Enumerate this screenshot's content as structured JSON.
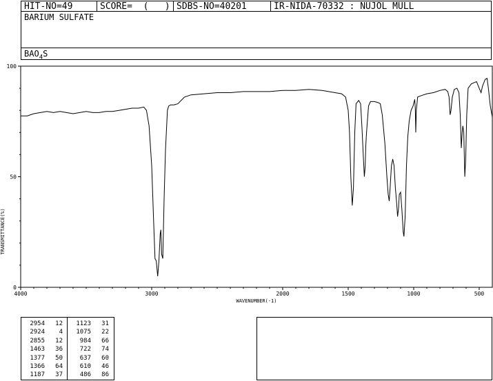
{
  "header": {
    "hit_no": "HIT-NO=49",
    "score": "SCORE=  (   )",
    "sdbs_no": "SDBS-NO=40201",
    "ir_nida": "IR-NIDA-70332 : NUJOL MULL"
  },
  "compound": {
    "name": "BARIUM SULFATE",
    "formula_pre": "BAO",
    "formula_sub": "4",
    "formula_post": "S"
  },
  "chart_data": {
    "type": "line",
    "xlabel": "WAVENUMBER(-1)",
    "ylabel": "TRANSMITTANCE(%)",
    "xlim": [
      4000,
      400
    ],
    "ylim": [
      0,
      100
    ],
    "x_ticks": [
      4000,
      3000,
      2000,
      1500,
      1000,
      500
    ],
    "y_ticks": [
      0,
      50,
      100
    ],
    "x_tick_labels": [
      "4000",
      "3000",
      "2000",
      "1500",
      "1000",
      "500"
    ],
    "y_tick_labels": [
      "0",
      "50",
      "100"
    ],
    "grid": false,
    "series": [
      {
        "points": [
          [
            4000,
            77.5
          ],
          [
            3950,
            77.5
          ],
          [
            3900,
            78.5
          ],
          [
            3850,
            79
          ],
          [
            3800,
            79.5
          ],
          [
            3750,
            79
          ],
          [
            3700,
            79.5
          ],
          [
            3650,
            79
          ],
          [
            3600,
            78.5
          ],
          [
            3550,
            79
          ],
          [
            3500,
            79.5
          ],
          [
            3450,
            79
          ],
          [
            3400,
            79
          ],
          [
            3350,
            79.5
          ],
          [
            3300,
            79.5
          ],
          [
            3250,
            80
          ],
          [
            3200,
            80.5
          ],
          [
            3150,
            81
          ],
          [
            3100,
            81
          ],
          [
            3060,
            81.5
          ],
          [
            3040,
            80
          ],
          [
            3020,
            73
          ],
          [
            3000,
            55
          ],
          [
            2985,
            30
          ],
          [
            2975,
            13
          ],
          [
            2965,
            12
          ],
          [
            2954,
            5
          ],
          [
            2945,
            12
          ],
          [
            2935,
            24
          ],
          [
            2930,
            26
          ],
          [
            2924,
            15
          ],
          [
            2915,
            13
          ],
          [
            2905,
            40
          ],
          [
            2895,
            62
          ],
          [
            2880,
            80
          ],
          [
            2870,
            82
          ],
          [
            2855,
            82.5
          ],
          [
            2830,
            82.5
          ],
          [
            2800,
            83
          ],
          [
            2750,
            86
          ],
          [
            2700,
            87
          ],
          [
            2600,
            87.5
          ],
          [
            2500,
            88
          ],
          [
            2400,
            88
          ],
          [
            2300,
            88.5
          ],
          [
            2200,
            88.5
          ],
          [
            2100,
            88.5
          ],
          [
            2000,
            89
          ],
          [
            1900,
            89
          ],
          [
            1800,
            89.5
          ],
          [
            1700,
            89
          ],
          [
            1600,
            88
          ],
          [
            1550,
            87.5
          ],
          [
            1520,
            86
          ],
          [
            1500,
            80
          ],
          [
            1490,
            70
          ],
          [
            1480,
            50
          ],
          [
            1469,
            37
          ],
          [
            1460,
            45
          ],
          [
            1450,
            70
          ],
          [
            1440,
            83
          ],
          [
            1420,
            84.5
          ],
          [
            1405,
            83
          ],
          [
            1395,
            72
          ],
          [
            1385,
            60
          ],
          [
            1377,
            50
          ],
          [
            1370,
            55
          ],
          [
            1366,
            64
          ],
          [
            1360,
            70
          ],
          [
            1345,
            82
          ],
          [
            1330,
            84
          ],
          [
            1300,
            84
          ],
          [
            1270,
            83.5
          ],
          [
            1255,
            83
          ],
          [
            1240,
            78
          ],
          [
            1220,
            65
          ],
          [
            1205,
            50
          ],
          [
            1195,
            42
          ],
          [
            1187,
            39
          ],
          [
            1180,
            45
          ],
          [
            1170,
            55
          ],
          [
            1160,
            58
          ],
          [
            1150,
            55
          ],
          [
            1140,
            45
          ],
          [
            1130,
            38
          ],
          [
            1123,
            32
          ],
          [
            1115,
            36
          ],
          [
            1110,
            42
          ],
          [
            1100,
            43
          ],
          [
            1090,
            35
          ],
          [
            1080,
            25
          ],
          [
            1075,
            23
          ],
          [
            1065,
            32
          ],
          [
            1055,
            55
          ],
          [
            1045,
            68
          ],
          [
            1035,
            75
          ],
          [
            1020,
            80
          ],
          [
            1005,
            82
          ],
          [
            992,
            85
          ],
          [
            988,
            81
          ],
          [
            984,
            70
          ],
          [
            980,
            80
          ],
          [
            970,
            86
          ],
          [
            950,
            86.5
          ],
          [
            900,
            87.5
          ],
          [
            850,
            88
          ],
          [
            800,
            89
          ],
          [
            760,
            89.5
          ],
          [
            740,
            88.5
          ],
          [
            730,
            86
          ],
          [
            722,
            78
          ],
          [
            715,
            80
          ],
          [
            705,
            86
          ],
          [
            690,
            89.5
          ],
          [
            670,
            90
          ],
          [
            655,
            88
          ],
          [
            645,
            78
          ],
          [
            637,
            63
          ],
          [
            630,
            70
          ],
          [
            625,
            73
          ],
          [
            618,
            70
          ],
          [
            610,
            50
          ],
          [
            603,
            58
          ],
          [
            595,
            78
          ],
          [
            585,
            90
          ],
          [
            560,
            92
          ],
          [
            540,
            92.5
          ],
          [
            520,
            93
          ],
          [
            500,
            90
          ],
          [
            486,
            88
          ],
          [
            475,
            91
          ],
          [
            455,
            94
          ],
          [
            440,
            94.5
          ],
          [
            430,
            90
          ],
          [
            415,
            82
          ],
          [
            400,
            77
          ]
        ]
      }
    ]
  },
  "peak_table": {
    "left": [
      {
        "wn": "2954",
        "t": "12"
      },
      {
        "wn": "2924",
        "t": "4"
      },
      {
        "wn": "2855",
        "t": "12"
      },
      {
        "wn": "1463",
        "t": "36"
      },
      {
        "wn": "1377",
        "t": "50"
      },
      {
        "wn": "1366",
        "t": "64"
      },
      {
        "wn": "1187",
        "t": "37"
      }
    ],
    "right": [
      {
        "wn": "1123",
        "t": "31"
      },
      {
        "wn": "1075",
        "t": "22"
      },
      {
        "wn": "984",
        "t": "66"
      },
      {
        "wn": "722",
        "t": "74"
      },
      {
        "wn": "637",
        "t": "60"
      },
      {
        "wn": "610",
        "t": "46"
      },
      {
        "wn": "486",
        "t": "86"
      }
    ]
  }
}
